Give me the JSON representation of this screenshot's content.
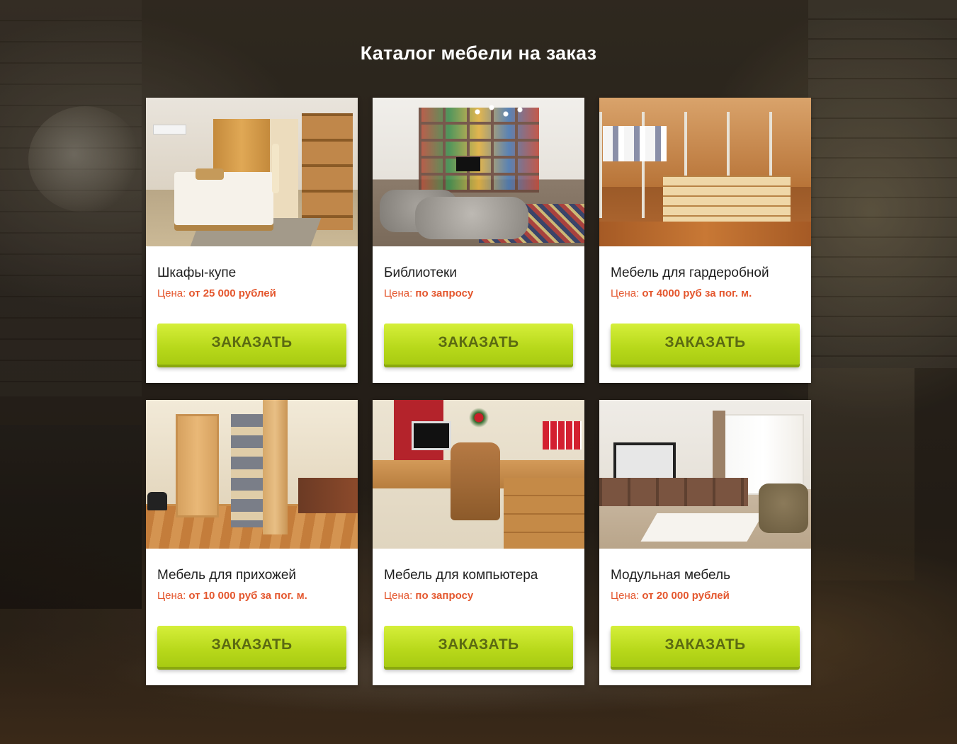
{
  "page": {
    "title": "Каталог мебели на заказ"
  },
  "colors": {
    "price_text": "#e4572e",
    "button_gradient_top": "#d5ef3a",
    "button_gradient_bottom": "#a8cb12",
    "button_text": "#5b6a12",
    "title_text": "#ffffff"
  },
  "products": [
    {
      "name": "Шкафы-купе",
      "price_label": "Цена:",
      "price_value": "от 25 000 рублей",
      "button_label": "ЗАКАЗАТЬ",
      "image": "wardrobe-bedroom-photo"
    },
    {
      "name": "Библиотеки",
      "price_label": "Цена:",
      "price_value": "по запросу",
      "button_label": "ЗАКАЗАТЬ",
      "image": "library-living-room-photo"
    },
    {
      "name": "Мебель для гардеробной",
      "price_label": "Цена:",
      "price_value": "от 4000 руб за пог. м.",
      "button_label": "ЗАКАЗАТЬ",
      "image": "walk-in-closet-photo"
    },
    {
      "name": "Мебель для прихожей",
      "price_label": "Цена:",
      "price_value": "от 10 000 руб за пог. м.",
      "button_label": "ЗАКАЗАТЬ",
      "image": "hallway-furniture-photo"
    },
    {
      "name": "Мебель для компьютера",
      "price_label": "Цена:",
      "price_value": "по запросу",
      "button_label": "ЗАКАЗАТЬ",
      "image": "computer-desk-office-photo"
    },
    {
      "name": "Модульная мебель",
      "price_label": "Цена:",
      "price_value": "от 20 000 рублей",
      "button_label": "ЗАКАЗАТЬ",
      "image": "modular-living-room-photo"
    }
  ]
}
